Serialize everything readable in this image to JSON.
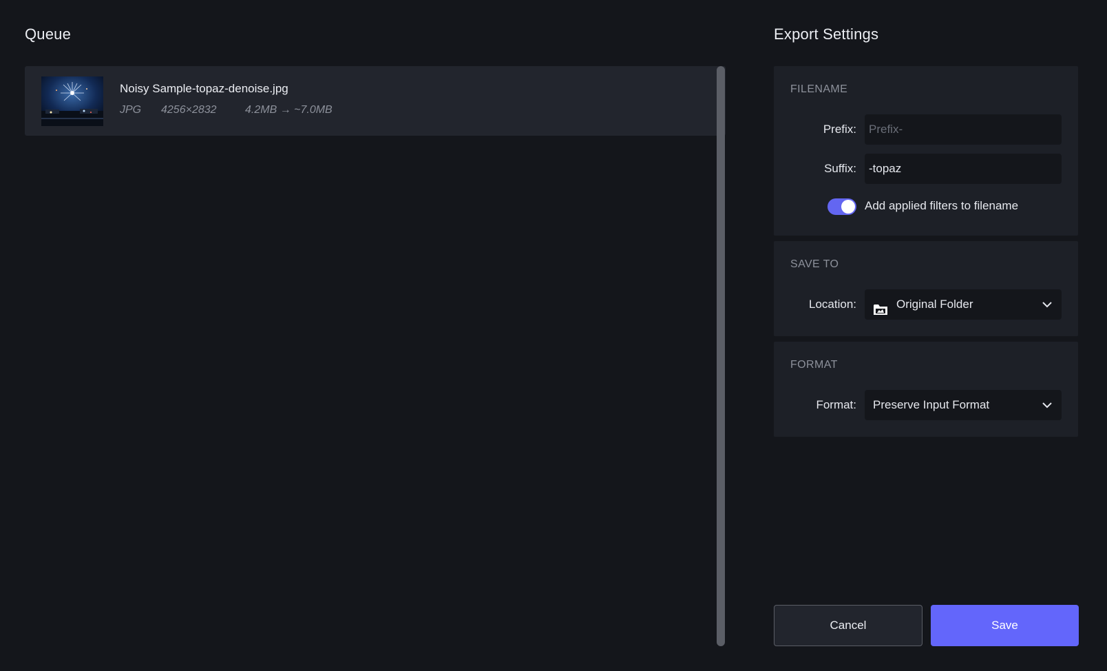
{
  "queue": {
    "title": "Queue",
    "items": [
      {
        "name": "Noisy Sample-topaz-denoise.jpg",
        "format": "JPG",
        "dimensions": "4256×2832",
        "size": "4.2MB → ~7.0MB"
      }
    ]
  },
  "export": {
    "title": "Export Settings",
    "filename": {
      "section": "FILENAME",
      "prefix_label": "Prefix:",
      "prefix_placeholder": "Prefix-",
      "prefix_value": "",
      "suffix_label": "Suffix:",
      "suffix_value": "-topaz",
      "toggle_label": "Add applied filters to filename",
      "toggle_on": true
    },
    "save_to": {
      "section": "SAVE TO",
      "location_label": "Location:",
      "location_value": "Original Folder"
    },
    "format": {
      "section": "FORMAT",
      "format_label": "Format:",
      "format_value": "Preserve Input Format"
    }
  },
  "actions": {
    "cancel_label": "Cancel",
    "save_label": "Save"
  },
  "colors": {
    "accent": "#6366fb",
    "background": "#14161b",
    "panel": "#1d2027"
  },
  "icons": {
    "location": "folder-icon",
    "dropdown": "chevron-down-icon"
  }
}
